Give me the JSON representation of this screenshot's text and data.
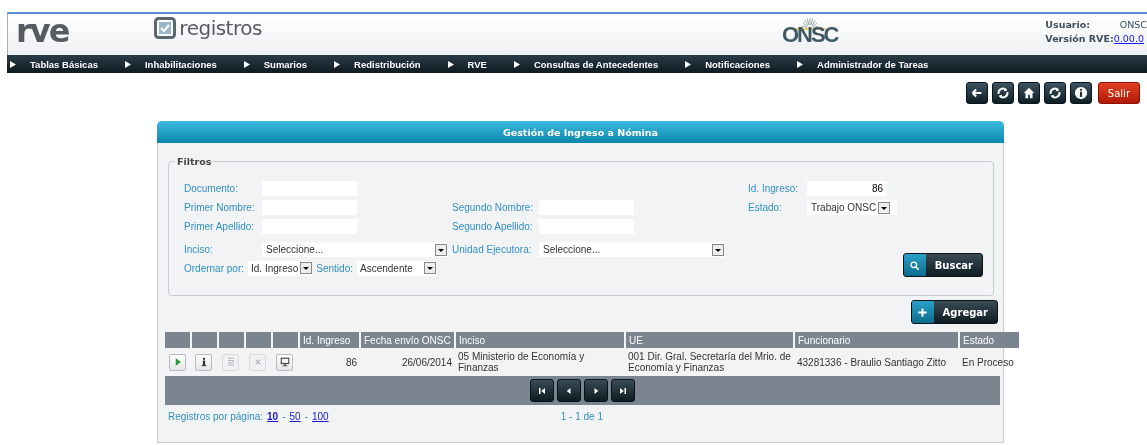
{
  "header": {
    "logo": "rve",
    "app_name": "registros",
    "organization": "ONSC",
    "user_label": "Usuario:",
    "user": "ONSC",
    "version_label": "Versión RVE:",
    "version": "0.00.0"
  },
  "menu": [
    {
      "label": "Tablas Básicas"
    },
    {
      "label": "Inhabilitaciones"
    },
    {
      "label": "Sumarios"
    },
    {
      "label": "Redistribución"
    },
    {
      "label": "RVE"
    },
    {
      "label": "Consultas de Antecedentes"
    },
    {
      "label": "Notificaciones"
    },
    {
      "label": "Administrador de Tareas"
    }
  ],
  "toolbar": [
    {
      "kind": "back"
    },
    {
      "kind": "refresh"
    },
    {
      "kind": "home"
    },
    {
      "kind": "refresh"
    },
    {
      "kind": "info"
    }
  ],
  "logout_button": "Salir",
  "panel": {
    "title": "Gestión de Ingreso a Nómina"
  },
  "filters": {
    "legend": "Filtros",
    "rows": [
      {
        "left": {
          "label": "Documento:",
          "kind": "text"
        },
        "right": {
          "label": "Id. Ingreso:",
          "kind": "text",
          "value": "86"
        }
      },
      {
        "left": {
          "label": "Primer Nombre:",
          "kind": "text"
        },
        "middle": {
          "label": "Segundo Nombre:",
          "kind": "text"
        },
        "right": {
          "label": "Estado:",
          "kind": "select",
          "value": "Trabajo ONSC"
        }
      },
      {
        "left": {
          "label": "Primer Apellido:",
          "kind": "text"
        },
        "middle": {
          "label": "Segundo Apellido:",
          "kind": "text"
        }
      },
      {
        "left": {
          "label": "Inciso:",
          "kind": "wide_select",
          "value": "Seleccione..."
        },
        "middle": {
          "label": "Unidad Ejecutora:",
          "kind": "wide_select",
          "value": "Seleccione..."
        }
      }
    ],
    "sort": {
      "order_label": "Ordernar por:",
      "order_value": "Id. Ingreso",
      "direction_label": "Sentido:",
      "direction_value": "Ascendente"
    },
    "search_button": "Buscar"
  },
  "add_button": "Agregar",
  "table": {
    "columns": [
      {
        "label": "Id. Ingreso"
      },
      {
        "label": "Fecha envío ONSC"
      },
      {
        "label": "Inciso"
      },
      {
        "label": "UE"
      },
      {
        "label": "Funcionario"
      },
      {
        "label": "Estado"
      }
    ],
    "rows": [
      {
        "actions": [
          {
            "kind": "play",
            "disabled": false
          },
          {
            "kind": "info",
            "disabled": false
          },
          {
            "kind": "document",
            "disabled": true
          },
          {
            "kind": "delete",
            "disabled": true
          },
          {
            "kind": "monitor",
            "disabled": false
          }
        ],
        "cells": [
          "86",
          "26/06/2014",
          "05 Ministerio de Economía y Finanzas",
          "001 Dir. Gral. Secretaría del Mrio. de Economía y Finanzas",
          "43281336 - Braulio Santiago Zitto",
          "En Proceso"
        ]
      }
    ]
  },
  "pager": [
    {
      "kind": "first"
    },
    {
      "kind": "prev"
    },
    {
      "kind": "next"
    },
    {
      "kind": "last"
    }
  ],
  "footer": {
    "page_size_label": "Registros por página:",
    "page_sizes": [
      {
        "label": "10",
        "selected": true
      },
      {
        "label": "50",
        "selected": false
      },
      {
        "label": "100",
        "selected": false
      }
    ],
    "separator": "-",
    "range": "1 - 1 de 1"
  }
}
